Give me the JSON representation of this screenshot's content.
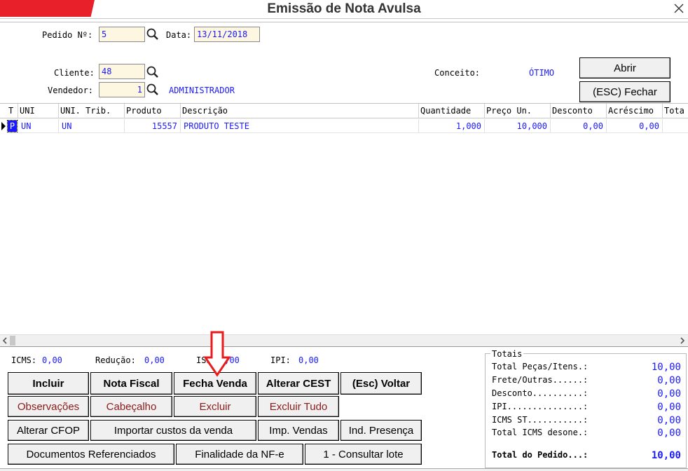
{
  "window": {
    "title": "Emissão de Nota Avulsa"
  },
  "header": {
    "pedido_label": "Pedido Nº:",
    "pedido_value": "5",
    "data_label": "Data:",
    "data_value": "13/11/2018",
    "cliente_label": "Cliente:",
    "cliente_value": "48",
    "vendedor_label": "Vendedor:",
    "vendedor_value": "1",
    "vendedor_name": "ADMINISTRADOR",
    "conceito_label": "Conceito:",
    "conceito_value": "ÓTIMO",
    "abrir_label": "Abrir",
    "fechar_label": "(ESC) Fechar"
  },
  "grid": {
    "columns": [
      "T",
      "UNI",
      "UNI. Trib.",
      "Produto",
      "Descrição",
      "Quantidade",
      "Preço Un.",
      "Desconto",
      "Acréscimo",
      "Tota"
    ],
    "rows": [
      {
        "t": "P",
        "uni": "UN",
        "uni_trib": "UN",
        "produto": "15557",
        "descricao": "PRODUTO TESTE",
        "quantidade": "1,000",
        "preco": "10,000",
        "desconto": "0,00",
        "acrescimo": "0,00"
      }
    ]
  },
  "taxes": {
    "icms_label": "ICMS:",
    "icms_value": "0,00",
    "reducao_label": "Redução:",
    "reducao_value": "0,00",
    "iss_label": "ISS:",
    "iss_value": "0,00",
    "ipi_label": "IPI:",
    "ipi_value": "0,00"
  },
  "buttons": {
    "incluir": "Incluir",
    "nota_fiscal": "Nota Fiscal",
    "fecha_venda": "Fecha Venda",
    "alterar_cest": "Alterar CEST",
    "voltar": "(Esc) Voltar",
    "observacoes": "Observações",
    "cabecalho": "Cabeçalho",
    "excluir": "Excluir",
    "excluir_tudo": "Excluir Tudo",
    "alterar_cfop": "Alterar CFOP",
    "importar_custos": "Importar custos da venda",
    "imp_vendas": "Imp. Vendas",
    "ind_presenca": "Ind. Presença",
    "documentos": "Documentos Referenciados",
    "finalidade": "Finalidade da NF-e",
    "consultar_lote": "1 - Consultar lote"
  },
  "totals": {
    "title": "Totais",
    "rows": [
      {
        "label": "Total Peças/Itens.:",
        "value": "10,00"
      },
      {
        "label": "Frete/Outras......:",
        "value": "0,00"
      },
      {
        "label": "Desconto..........:",
        "value": "0,00"
      },
      {
        "label": "IPI...............:",
        "value": "0,00"
      },
      {
        "label": "ICMS ST...........:",
        "value": "0,00"
      },
      {
        "label": "Total ICMS desone.:",
        "value": "0,00"
      }
    ],
    "total_label": "Total do Pedido...:",
    "total_value": "10,00"
  },
  "colors": {
    "accent": "#e8202a",
    "value_blue": "#1a1aff",
    "field_bg": "#fdf6e0"
  }
}
